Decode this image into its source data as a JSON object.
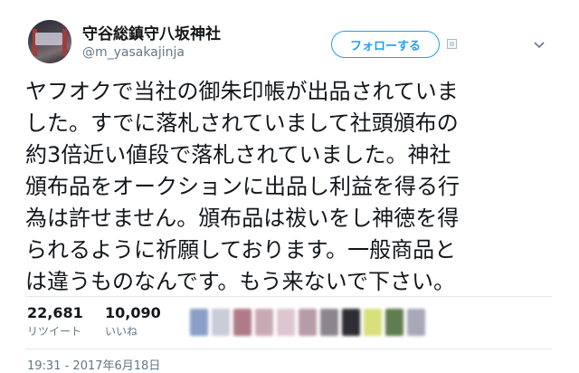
{
  "account": {
    "display_name": "守谷総鎮守八坂神社",
    "handle": "@m_yasakajinja"
  },
  "actions": {
    "follow_label": "フォローする"
  },
  "icons": {
    "notification": "notification-icon",
    "more": "chevron-down-icon"
  },
  "tweet": {
    "text": "ヤフオクで当社の御朱印帳が出品されていま\nした。すでに落札されていまして社頭頒布の\n約3倍近い値段で落札されていました。神社\n頒布品をオークションに出品し利益を得る行\n為は許せません。頒布品は祓いをし神徳を得\nられるように祈願しております。一般商品と\nは違うものなんです。もう来ないで下さい。"
  },
  "stats": {
    "retweets": {
      "count": "22,681",
      "label": "リツイート"
    },
    "likes": {
      "count": "10,090",
      "label": "いいね"
    }
  },
  "liker_avatar_colors": [
    "#8aa0c8",
    "#c9ccd6",
    "#b07a88",
    "#c9a9b4",
    "#dcc6cf",
    "#b89ba8",
    "#8c8590",
    "#2e2e34",
    "#d8e07a",
    "#5f7d4f",
    "#a8a8b8"
  ],
  "timestamp": "19:31 - 2017年6月18日",
  "colors": {
    "accent": "#1da1f2",
    "text": "#14171a",
    "muted": "#657786"
  }
}
